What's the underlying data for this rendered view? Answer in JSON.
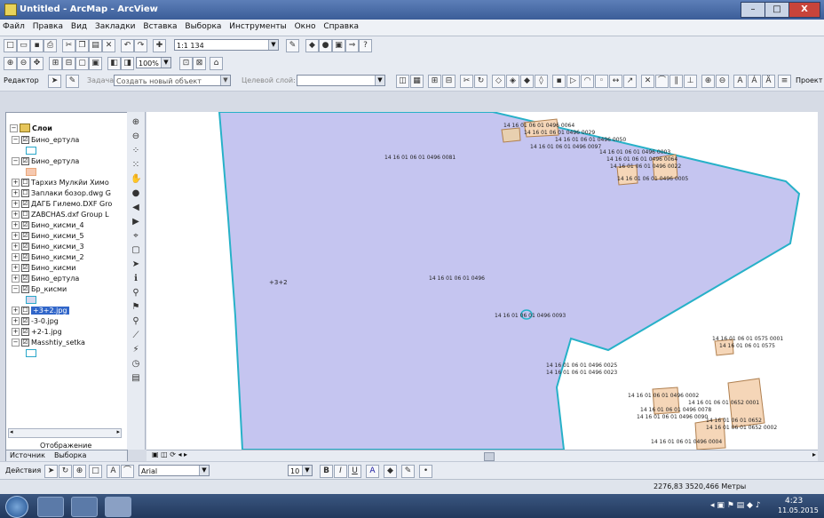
{
  "window": {
    "title": "Untitled - ArcMap - ArcView"
  },
  "menu": [
    "Файл",
    "Правка",
    "Вид",
    "Закладки",
    "Вставка",
    "Выборка",
    "Инструменты",
    "Окно",
    "Справка"
  ],
  "toolbar": {
    "scale": "1:1 134",
    "zoom": "100%"
  },
  "editor": {
    "label": "Редактор",
    "task_label": "Задача:",
    "task_value": "Создать новый объект",
    "target_label": "Целевой слой:"
  },
  "toc": {
    "root": "Слои",
    "layers": [
      {
        "name": "Бино_ертула",
        "check": "☑",
        "sym": "#2aa7c9",
        "fill": "#ffffff"
      },
      {
        "name": "Бино_ертула",
        "check": "☑",
        "sym": "#e9a77a",
        "fill": "#f6c9b0"
      },
      {
        "name": "Тархиз Мулкйи Химо",
        "check": "☐"
      },
      {
        "name": "Заплаки бозор.dwg G",
        "check": "☐"
      },
      {
        "name": "ДАГБ Гилемо.DXF Gro",
        "check": "☑"
      },
      {
        "name": "ZABCHAS.dxf Group L",
        "check": "☐"
      },
      {
        "name": "Бино_кисми_4",
        "check": "☑"
      },
      {
        "name": "Бино_кисми_5",
        "check": "☑"
      },
      {
        "name": "Бино_кисми_3",
        "check": "☑"
      },
      {
        "name": "Бино_кисми_2",
        "check": "☑"
      },
      {
        "name": "Бино_кисми",
        "check": "☑"
      },
      {
        "name": "Бино_ертула",
        "check": "☑"
      },
      {
        "name": "Бр_кисми",
        "check": "☑",
        "sym": "#2aa7c9",
        "fill": "#d8d8ee"
      },
      {
        "name": "+3+2.jpg",
        "check": "☐",
        "selected": true
      },
      {
        "name": "-3-0.jpg",
        "check": "☑"
      },
      {
        "name": "+2-1.jpg",
        "check": "☑"
      },
      {
        "name": "Masshtiy_setka",
        "check": "☑",
        "sym": "#2aa7c9",
        "fill": "#ffffff"
      }
    ],
    "tab_display": "Отображение",
    "tab_source": "Источник",
    "tab_selection": "Выборка"
  },
  "map": {
    "main_label": "14 16 01 06 01 0496",
    "left_label": "+3+2",
    "labels": [
      "14 16 01 06 01 0496 0064",
      "14 16 01 06 01 0496 0029",
      "14 16 01 06 01 0496 0050",
      "14 16 01 06 01 0496 0097",
      "14 16 01 06 01 0496 0081",
      "14 16 01 06 01 0496 0003",
      "14 16 01 06 01 0496 0064",
      "14 16 01 06 01 0496 0022",
      "14 16 01 06 01 0496 0005",
      "14 16 01 06 01 0496 0093",
      "14 16 01 06 01 0575 0001",
      "14 16 01 06 01 0575",
      "14 16 01 06 01 0496 0025",
      "14 16 01 06 01 0496 0023",
      "14 16 01 06 01 0496 0002",
      "14 16 01 06 01 0496 0078",
      "14 16 01 06 01 0496 0090",
      "14 16 01 06 01 0652 0001",
      "14 16 01 06 01 0652",
      "14 16 01 06 01 0652 0002",
      "14 16 01 06 01 0496 0004"
    ],
    "colors": {
      "polygon": "#c5c5f0",
      "outline": "#27b1c8",
      "parcel": "#f5d6b8"
    }
  },
  "draw": {
    "actions": "Действия",
    "font": "Arial",
    "size": "10"
  },
  "status": {
    "coords": "2276,83  3520,466 Метры"
  },
  "taskbar": {
    "time": "4:23",
    "date": "11.05.2015"
  }
}
